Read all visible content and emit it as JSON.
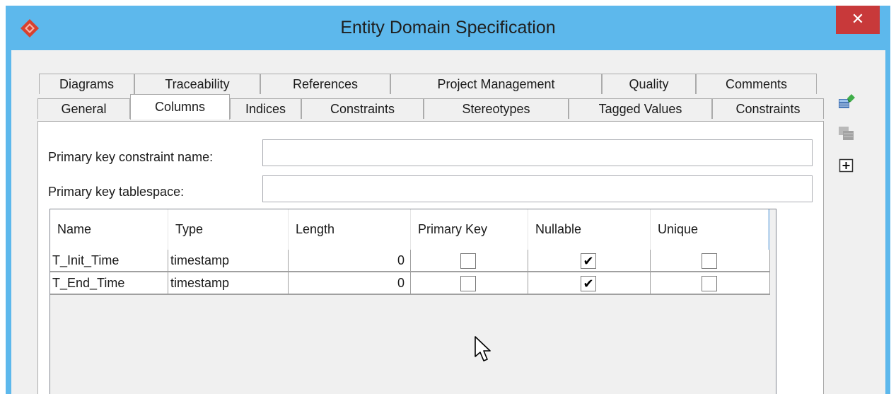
{
  "window": {
    "title": "Entity Domain Specification",
    "close_glyph": "✕",
    "app_icon": "diamond-logo-icon",
    "accent": "#5db8ec",
    "close_color": "#c8393a"
  },
  "tabs_top": [
    {
      "label": "Diagrams"
    },
    {
      "label": "Traceability"
    },
    {
      "label": "References"
    },
    {
      "label": "Project Management"
    },
    {
      "label": "Quality"
    },
    {
      "label": "Comments"
    }
  ],
  "tabs_bottom": [
    {
      "label": "General"
    },
    {
      "label": "Columns",
      "active": true
    },
    {
      "label": "Indices"
    },
    {
      "label": "Constraints"
    },
    {
      "label": "Stereotypes"
    },
    {
      "label": "Tagged Values"
    },
    {
      "label": "Constraints"
    }
  ],
  "form": {
    "pk_constraint_label": "Primary key constraint name:",
    "pk_constraint_value": "",
    "pk_tablespace_label": "Primary key tablespace:",
    "pk_tablespace_value": ""
  },
  "grid": {
    "columns": [
      "Name",
      "Type",
      "Length",
      "Primary Key",
      "Nullable",
      "Unique"
    ],
    "rows": [
      {
        "name": "T_Init_Time",
        "type": "timestamp",
        "length": "0",
        "primary_key": false,
        "nullable": true,
        "unique": false
      },
      {
        "name": "T_End_Time",
        "type": "timestamp",
        "length": "0",
        "primary_key": false,
        "nullable": true,
        "unique": false
      }
    ],
    "check_glyph": "✔"
  },
  "side_buttons": [
    "add-column-icon",
    "remove-column-icon",
    "expand-icon"
  ]
}
